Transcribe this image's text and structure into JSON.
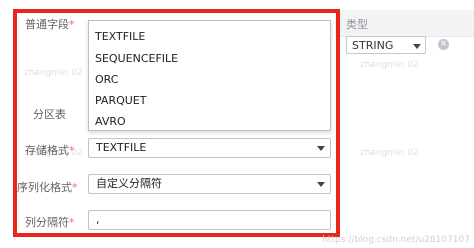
{
  "fields_section": {
    "label": "普通字段",
    "required_mark": "*",
    "columns": [
      "类型"
    ],
    "type_select": {
      "value": "STRING"
    }
  },
  "partition_section": {
    "label": "分区表"
  },
  "storage_format": {
    "label": "存储格式",
    "required_mark": "*",
    "value": "TEXTFILE",
    "options": [
      "TEXTFILE",
      "SEQUENCEFILE",
      "ORC",
      "PARQUET",
      "AVRO"
    ]
  },
  "serialization_format": {
    "label": "序列化格式",
    "required_mark": "*",
    "value": "自定义分隔符"
  },
  "column_delimiter": {
    "label": "列分隔符",
    "required_mark": "*",
    "value": ","
  },
  "watermark": {
    "text": "zhangmin 02"
  },
  "credit": {
    "text": "https://blog.csdn.net/u28107107"
  },
  "colors": {
    "frame": "#e8261b",
    "required": "#f56c6c"
  },
  "icons": {
    "remove": "close-circle-icon",
    "caret": "caret-down-icon"
  }
}
